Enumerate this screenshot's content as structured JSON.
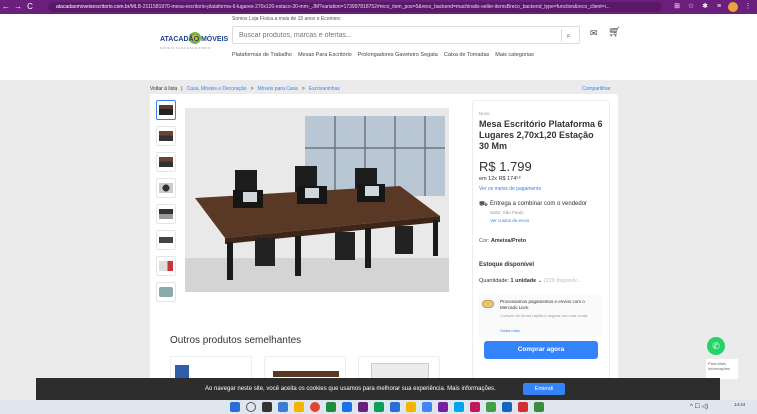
{
  "browser": {
    "back": "←",
    "forward": "→",
    "reload": "C",
    "url_domain": "atacadaomoveisescritorio.com.br",
    "url_path": "/MLB-2111581970-mesa-escritorio-plataforma-6-lugares-270x120-estaco-30-mm-_JM?variation=173997818752#reco_item_pos=5&reco_backend=machinalis-seller-itemsBreco_backend_type=function&reco_client=i..."
  },
  "header": {
    "promo": "Somos Loja Física a mais de 15 anos e Ecomerc",
    "logo_text": "ATACADÃO MÓVEIS",
    "logo_sub": "MÓVEIS PARA ESCRITÓRIO",
    "search_placeholder": "Buscar produtos, marcas e ofertas...",
    "categories": [
      "Plataformas de Trabalho",
      "Mesas Para Escritório",
      "Prolongadores Gaveteiro Segata",
      "Caixa de Tomadas",
      "Mais categorias"
    ]
  },
  "breadcrumb": {
    "back": "Voltar à lista",
    "items": [
      "Casa, Móveis e Decoração",
      "Móveis para Casa",
      "Escrivaninhas"
    ],
    "share": "Compartilhar"
  },
  "product": {
    "condition": "Novo",
    "title": "Mesa Escritório Plataforma 6 Lugares 2,70x1,20 Estação 30 Mm",
    "price": "R$ 1.799",
    "installments": "em 12x R$ 174⁵⁶",
    "payment_link": "Ver os meios de pagamento",
    "delivery": "Entrega a combinar com o vendedor",
    "location": "Salto, São Paulo",
    "shipping_link": "Ver custos de envio",
    "color_label": "Cor:",
    "color_value": "Ameixa/Preto",
    "stock": "Estoque disponível",
    "quantity_label": "Quantidade:",
    "quantity_value": "1 unidade",
    "quantity_available": "(229 disponív...",
    "mp_title": "Processamos pagamentos e envios com o Mercado Livre",
    "mp_text": "Compre de forma rápida e segura com sua conta.",
    "mp_link": "Saiba mais",
    "buy_button": "Comprar agora"
  },
  "similar": {
    "title": "Outros produtos semelhantes"
  },
  "floating": {
    "help": "Para Mais Informações"
  },
  "cookie": {
    "text": "Ao navegar neste site, você aceita os cookies que usamos para melhorar sua experiência. Mais informações.",
    "button": "Entendi"
  },
  "taskbar": {
    "time": "14:44",
    "date": "",
    "tray": "^ ☐ ◁)"
  },
  "colors": {
    "browser_bar": "#6b1f7c",
    "accent": "#3483fa",
    "cookie_bg": "#2d2d2d",
    "whatsapp": "#25d366"
  }
}
